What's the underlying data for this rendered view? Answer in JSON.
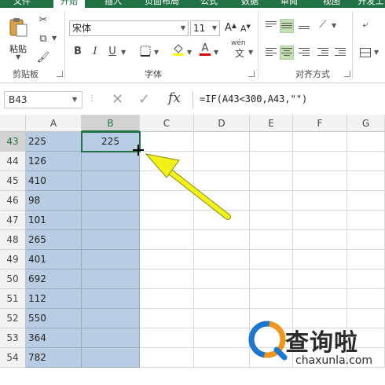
{
  "ribbon_tabs": [
    "文件",
    "开始",
    "插入",
    "页面布局",
    "公式",
    "数据",
    "审阅",
    "视图",
    "开发工"
  ],
  "ribbon_active_tab": "开始",
  "clipboard": {
    "paste_label": "粘贴",
    "group_label": "剪贴板"
  },
  "font": {
    "name": "宋体",
    "size": "11",
    "group_label": "字体",
    "grow_label": "A",
    "shrink_label": "A",
    "bold": "B",
    "italic": "I",
    "underline": "U",
    "font_color": "A",
    "phonetic_label": "wén"
  },
  "alignment": {
    "group_label": "对齐方式"
  },
  "formula_bar": {
    "name_box": "B43",
    "cancel_icon": "✕",
    "enter_icon": "✓",
    "fx_label": "fx",
    "formula": "=IF(A43<300,A43,\"\")"
  },
  "columns": [
    "A",
    "B",
    "C",
    "D",
    "E",
    "F",
    "G"
  ],
  "rows": [
    {
      "num": "43",
      "a": "225",
      "b": "225"
    },
    {
      "num": "44",
      "a": "126",
      "b": ""
    },
    {
      "num": "45",
      "a": "410",
      "b": ""
    },
    {
      "num": "46",
      "a": "98",
      "b": ""
    },
    {
      "num": "47",
      "a": "101",
      "b": ""
    },
    {
      "num": "48",
      "a": "265",
      "b": ""
    },
    {
      "num": "49",
      "a": "401",
      "b": ""
    },
    {
      "num": "50",
      "a": "692",
      "b": ""
    },
    {
      "num": "51",
      "a": "112",
      "b": ""
    },
    {
      "num": "52",
      "a": "550",
      "b": ""
    },
    {
      "num": "53",
      "a": "364",
      "b": ""
    },
    {
      "num": "54",
      "a": "782",
      "b": ""
    }
  ],
  "selected_cell": "B43",
  "colors": {
    "excel_green": "#217346",
    "selection_fill": "#b8cce4",
    "arrow_yellow": "#f2f21a"
  },
  "watermark": {
    "text": "查询啦",
    "sub": "chaxunla.com"
  }
}
